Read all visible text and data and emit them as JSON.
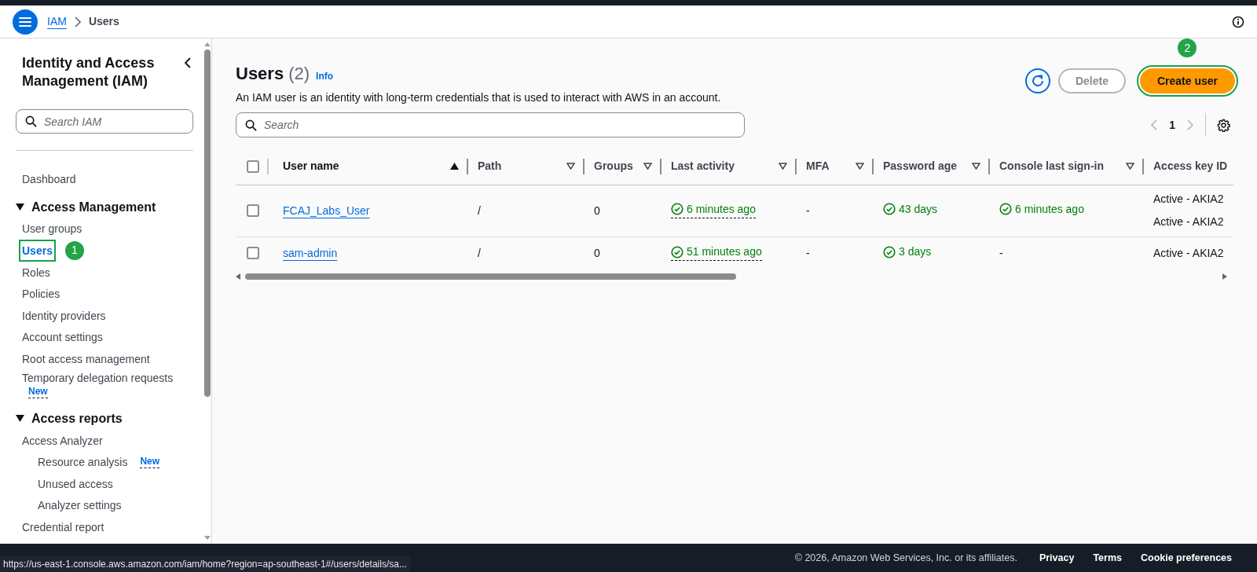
{
  "breadcrumbs": [
    {
      "label": "IAM",
      "current": false
    },
    {
      "label": "Users",
      "current": true
    }
  ],
  "sidebar": {
    "title": "Identity and Access Management (IAM)",
    "search": {
      "placeholder": "Search IAM"
    },
    "items": [
      {
        "label": "Dashboard",
        "kind": "item",
        "selected": false
      },
      {
        "label": "Access Management",
        "kind": "section",
        "expanded": true,
        "children": [
          {
            "label": "User groups",
            "kind": "item",
            "selected": false
          },
          {
            "label": "Users",
            "kind": "item",
            "selected": true,
            "highlighted": true,
            "marker": "1"
          },
          {
            "label": "Roles",
            "kind": "item",
            "selected": false
          },
          {
            "label": "Policies",
            "kind": "item",
            "selected": false
          },
          {
            "label": "Identity providers",
            "kind": "item",
            "selected": false
          },
          {
            "label": "Account settings",
            "kind": "item",
            "selected": false
          },
          {
            "label": "Root access management",
            "kind": "item",
            "selected": false
          },
          {
            "label": "Temporary delegation requests",
            "kind": "item",
            "selected": false,
            "badge": "New",
            "badge_below": true
          }
        ]
      },
      {
        "label": "Access reports",
        "kind": "section",
        "expanded": true,
        "children": [
          {
            "label": "Access Analyzer",
            "kind": "item",
            "selected": false,
            "children": [
              {
                "label": "Resource analysis",
                "kind": "item",
                "selected": false,
                "badge": "New"
              },
              {
                "label": "Unused access",
                "kind": "item",
                "selected": false
              },
              {
                "label": "Analyzer settings",
                "kind": "item",
                "selected": false
              }
            ]
          },
          {
            "label": "Credential report",
            "kind": "item",
            "selected": false
          }
        ]
      }
    ]
  },
  "main": {
    "title": "Users",
    "count": "(2)",
    "info": "Info",
    "description": "An IAM user is an identity with long-term credentials that is used to interact with AWS in an account.",
    "buttons": [
      {
        "kind": "refresh"
      },
      {
        "kind": "normal",
        "label": "Delete",
        "disabled": true
      },
      {
        "kind": "primary",
        "label": "Create user",
        "disabled": false,
        "highlighted": true,
        "marker": "2"
      }
    ],
    "search": {
      "placeholder": "Search"
    },
    "pagination": {
      "page": "1"
    },
    "table": {
      "all_selected": false,
      "columns": [
        {
          "label": "User name",
          "sortable": true,
          "sorted": true
        },
        {
          "label": "Path",
          "sortable": true,
          "sorted": false
        },
        {
          "label": "Groups",
          "sortable": true,
          "sorted": false
        },
        {
          "label": "Last activity",
          "sortable": true,
          "sorted": false
        },
        {
          "label": "MFA",
          "sortable": true,
          "sorted": false
        },
        {
          "label": "Password age",
          "sortable": true,
          "sorted": false
        },
        {
          "label": "Console last sign-in",
          "sortable": true,
          "sorted": false
        },
        {
          "label": "Access key ID",
          "sortable": false,
          "sorted": false
        }
      ],
      "rows": [
        {
          "selected": false,
          "cells": [
            {
              "kind": "link",
              "text": "FCAJ_Labs_User"
            },
            {
              "kind": "plain",
              "text": "/"
            },
            {
              "kind": "plain",
              "text": "0"
            },
            {
              "kind": "success_dotted",
              "text": "6 minutes ago"
            },
            {
              "kind": "plain",
              "text": "-"
            },
            {
              "kind": "success",
              "text": "43 days"
            },
            {
              "kind": "success",
              "text": "6 minutes ago"
            },
            {
              "kind": "lines",
              "lines": [
                "Active - AKIA2",
                "Active - AKIA2"
              ]
            }
          ]
        },
        {
          "selected": false,
          "cells": [
            {
              "kind": "link",
              "text": "sam-admin"
            },
            {
              "kind": "plain",
              "text": "/"
            },
            {
              "kind": "plain",
              "text": "0"
            },
            {
              "kind": "success_dotted",
              "text": "51 minutes ago"
            },
            {
              "kind": "plain",
              "text": "-"
            },
            {
              "kind": "success",
              "text": "3 days"
            },
            {
              "kind": "plain",
              "text": "-"
            },
            {
              "kind": "lines",
              "lines": [
                "Active - AKIA2"
              ]
            }
          ]
        }
      ]
    }
  },
  "footer": {
    "copyright": "© 2026, Amazon Web Services, Inc. or its affiliates.",
    "links": [
      "Privacy",
      "Terms",
      "Cookie preferences"
    ]
  },
  "status_url": "https://us-east-1.console.aws.amazon.com/iam/home?region=ap-southeast-1#/users/details/sa..."
}
